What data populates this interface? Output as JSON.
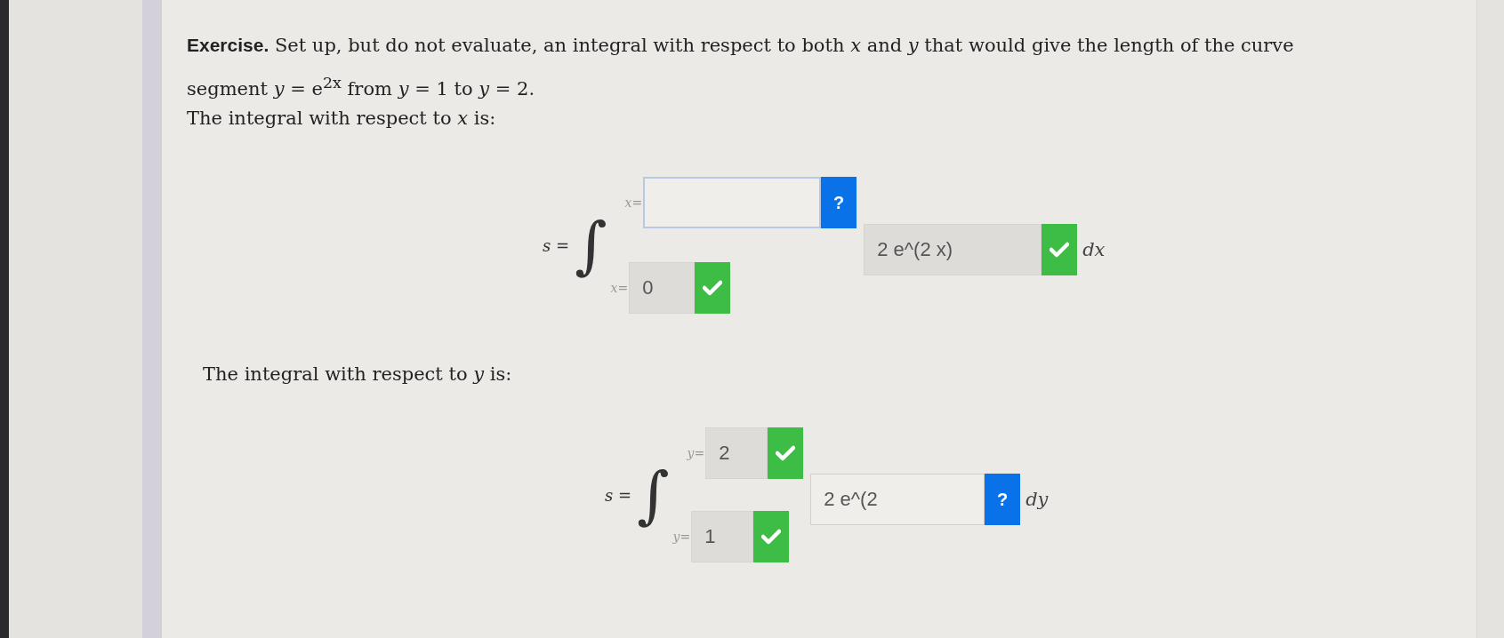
{
  "exercise": {
    "text": "**Exercise.** Set up, but do not evaluate, an integral with respect to both *x* and *y* that would give the length of the curve segment *y* = e$^{2x}$ from *y* = 1 to *y* = 2."
  },
  "integrals": [
    {
      "prompt": "The integral with respect to *x* is:",
      "lhs": "s =",
      "sign": "∫",
      "upper": {
        "label": "x=",
        "correct": false,
        "badge": "?",
        "focused": true
      },
      "lower": {
        "label": "x=",
        "value": "0",
        "correct": true
      },
      "integrand": {
        "value": "2 e^(2 x)",
        "correct": true
      },
      "differential": "dx"
    },
    {
      "prompt": "The integral with respect to *y* is:",
      "lhs": "s =",
      "sign": "∫",
      "upper": {
        "label": "y=",
        "value": "2",
        "correct": true
      },
      "lower": {
        "label": "y=",
        "value": "1",
        "correct": true
      },
      "integrand": {
        "value": "2 e^(2",
        "correct": false,
        "badge": "?",
        "focused": false
      },
      "differential": "dy"
    }
  ]
}
